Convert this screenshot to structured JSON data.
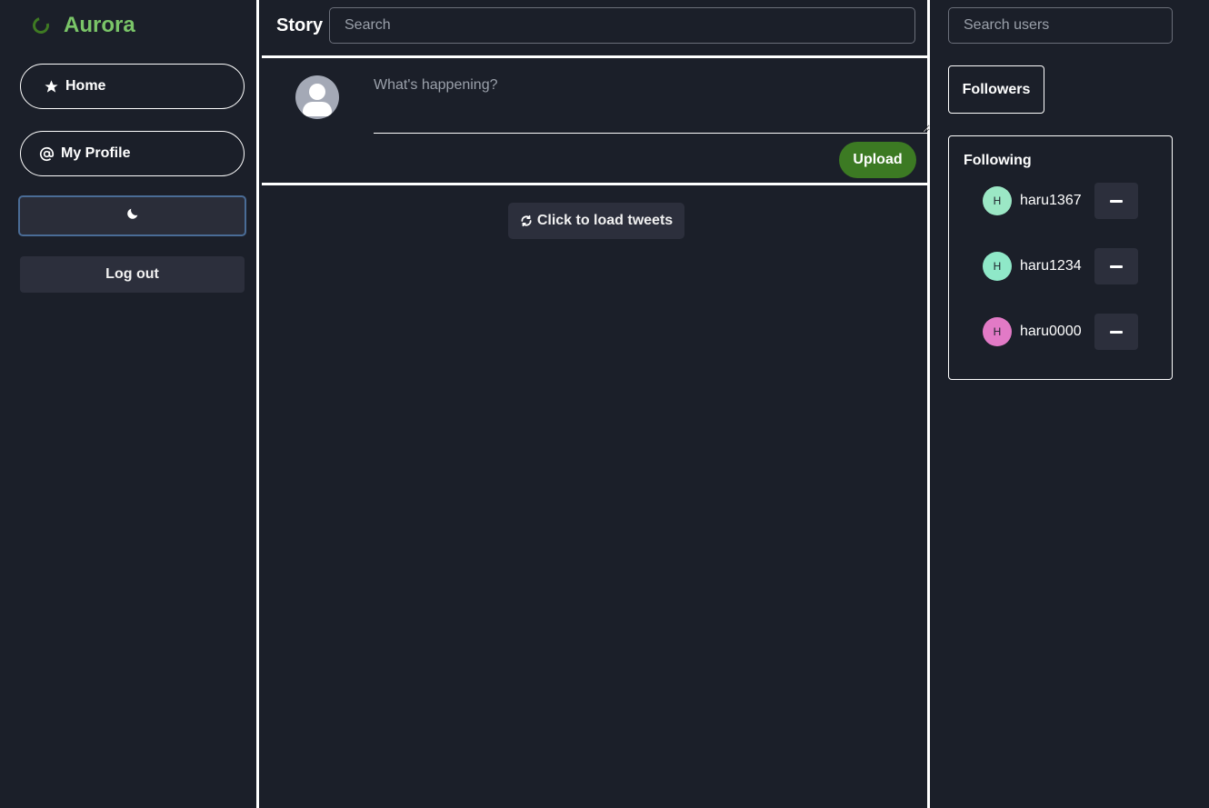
{
  "brand": {
    "name": "Aurora",
    "icon": "spinner-icon",
    "accent": "#7ac568"
  },
  "sidebar": {
    "items": [
      {
        "label": "Home",
        "icon": "star-icon"
      },
      {
        "label": "My Profile",
        "icon": "at-icon"
      }
    ],
    "theme_toggle_icon": "moon-icon",
    "logout_label": "Log out"
  },
  "main": {
    "title": "Story",
    "search_placeholder": "Search",
    "composer": {
      "placeholder": "What's happening?",
      "upload_label": "Upload",
      "upload_color": "#3c7a23"
    },
    "load_tweets_label": "Click to load tweets",
    "load_tweets_icon": "refresh-icon"
  },
  "right": {
    "search_placeholder": "Search users",
    "followers_label": "Followers",
    "following": {
      "title": "Following",
      "users": [
        {
          "initial": "H",
          "name": "haru1367",
          "color": "#9be7c5"
        },
        {
          "initial": "H",
          "name": "haru1234",
          "color": "#8fe8c8"
        },
        {
          "initial": "H",
          "name": "haru0000",
          "color": "#e27ac6"
        }
      ],
      "remove_icon": "minus-icon"
    }
  }
}
